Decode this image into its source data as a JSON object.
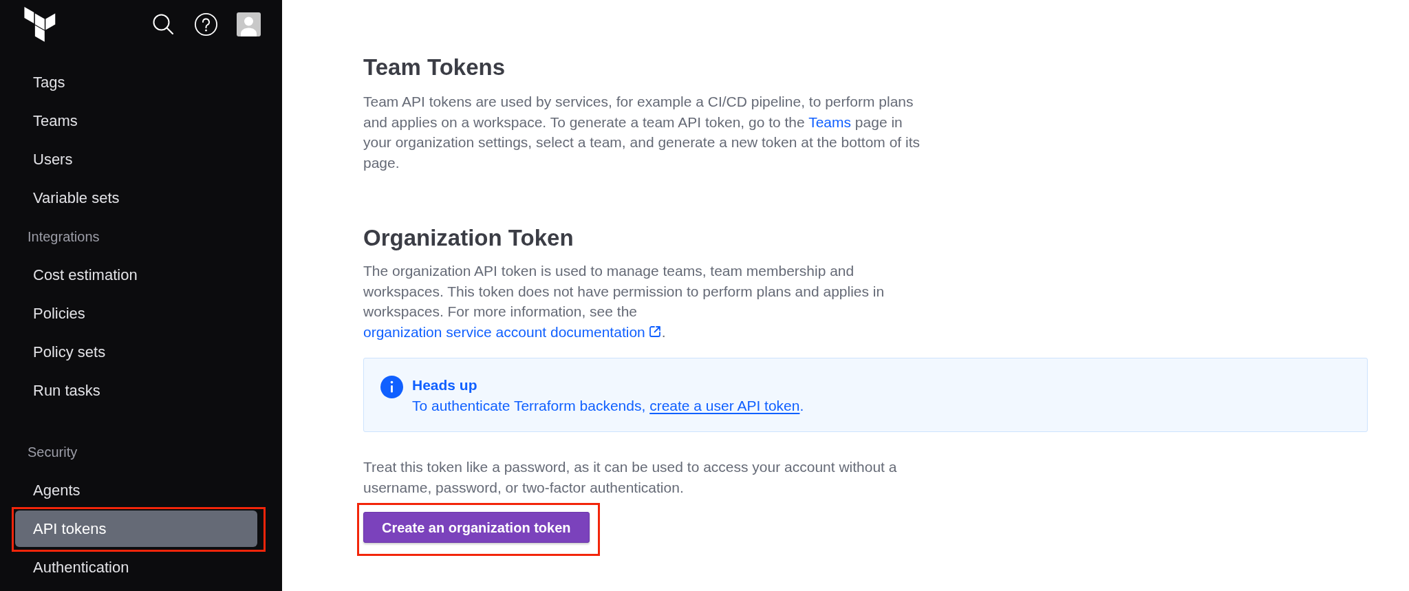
{
  "sidebar": {
    "sections": [
      {
        "items": [
          {
            "label": "Tags",
            "selected": false,
            "highlighted": false
          },
          {
            "label": "Teams",
            "selected": false,
            "highlighted": false
          },
          {
            "label": "Users",
            "selected": false,
            "highlighted": false
          },
          {
            "label": "Variable sets",
            "selected": false,
            "highlighted": false
          }
        ]
      },
      {
        "heading": "Integrations",
        "items": [
          {
            "label": "Cost estimation",
            "selected": false,
            "highlighted": false
          },
          {
            "label": "Policies",
            "selected": false,
            "highlighted": false
          },
          {
            "label": "Policy sets",
            "selected": false,
            "highlighted": false
          },
          {
            "label": "Run tasks",
            "selected": false,
            "highlighted": false
          }
        ]
      },
      {
        "heading": "Security",
        "items": [
          {
            "label": "Agents",
            "selected": false,
            "highlighted": false
          },
          {
            "label": "API tokens",
            "selected": true,
            "highlighted": true
          },
          {
            "label": "Authentication",
            "selected": false,
            "highlighted": false
          }
        ]
      }
    ]
  },
  "team_tokens": {
    "title": "Team Tokens",
    "description": [
      {
        "kind": "text",
        "text": "Team API tokens are used by services, for example a CI/CD pipeline, to perform plans and applies on a workspace. To generate a team API token, go to the "
      },
      {
        "kind": "link",
        "text": "Teams",
        "underlined": false
      },
      {
        "kind": "text",
        "text": " page in your organization settings, select a team, and generate a new token at the bottom of its page."
      }
    ]
  },
  "organization_token": {
    "title": "Organization Token",
    "description": [
      {
        "kind": "text",
        "text": "The organization API token is used to manage teams, team membership and workspaces. This token does not have permission to perform plans and applies in workspaces. For more information, see the "
      },
      {
        "kind": "external_link",
        "text": "organization service account documentation",
        "underlined": false
      },
      {
        "kind": "text",
        "text": "."
      }
    ],
    "callout": {
      "kind": "info",
      "title": "Heads up",
      "body": [
        {
          "kind": "text",
          "text": "To authenticate Terraform backends, "
        },
        {
          "kind": "link",
          "text": "create a user API token",
          "underlined": true
        },
        {
          "kind": "text",
          "text": "."
        }
      ]
    },
    "note": "Treat this token like a password, as it can be used to access your account without a username, password, or two-factor authentication.",
    "button": {
      "label": "Create an organization token",
      "highlighted": true
    }
  }
}
